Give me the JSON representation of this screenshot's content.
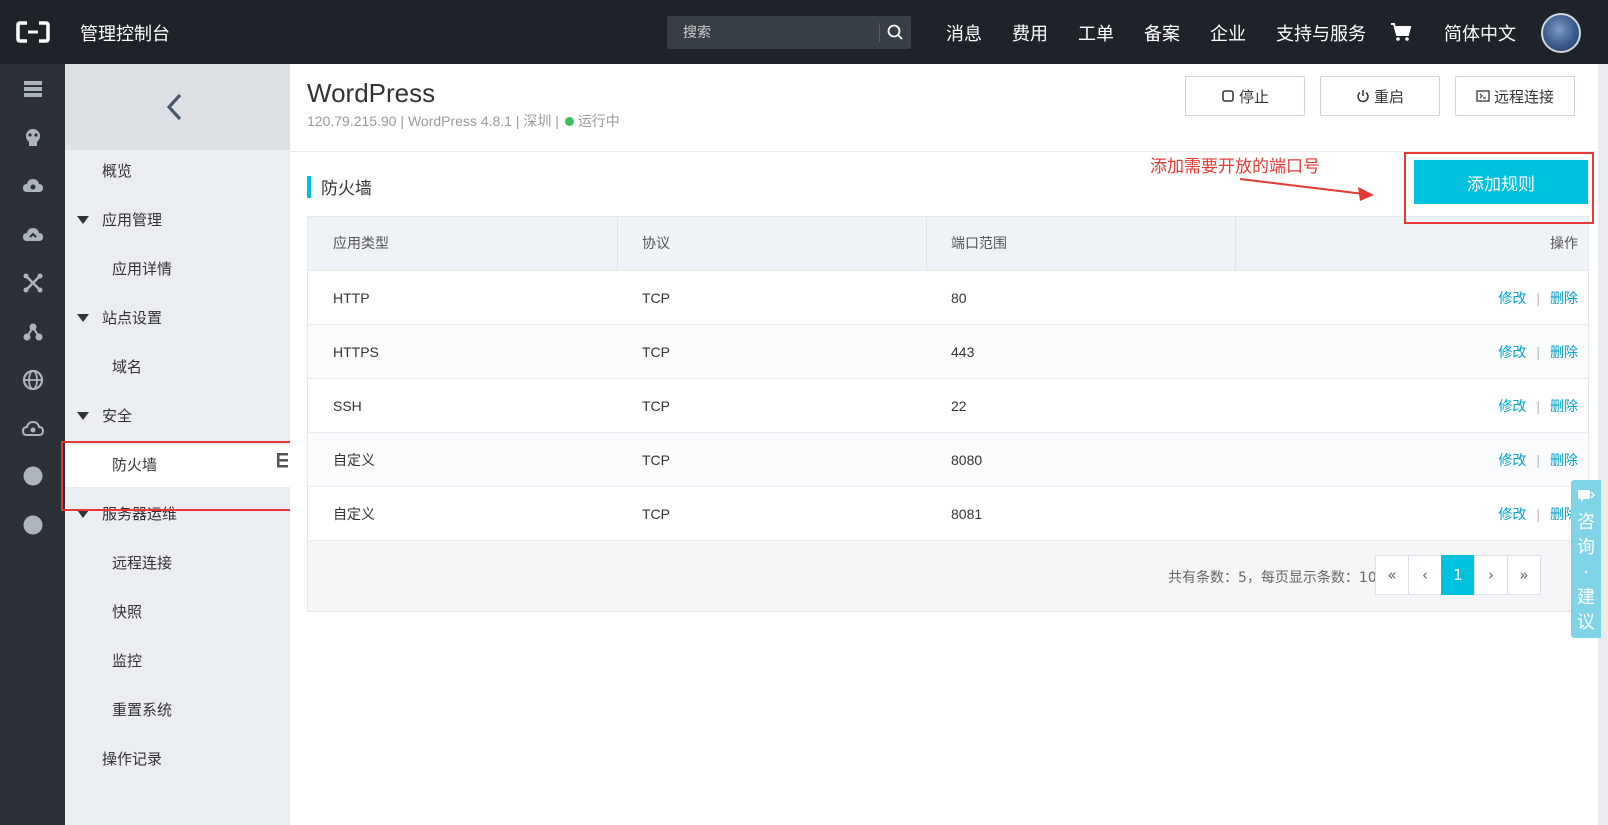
{
  "topbar": {
    "brand": "管理控制台",
    "search_placeholder": "搜索",
    "nav": [
      "消息",
      "费用",
      "工单",
      "备案",
      "企业",
      "支持与服务"
    ],
    "language": "简体中文"
  },
  "rail": {
    "icons": [
      "server-icon",
      "database-icon",
      "cloud-icon",
      "cloud-sync-icon",
      "network-icon",
      "cluster-icon",
      "globe-icon",
      "cloud-settings-icon",
      "circle-icon",
      "circle-icon"
    ]
  },
  "sidebar": {
    "items": [
      {
        "label": "概览",
        "type": "item"
      },
      {
        "label": "应用管理",
        "type": "group"
      },
      {
        "label": "应用详情",
        "type": "sub"
      },
      {
        "label": "站点设置",
        "type": "group"
      },
      {
        "label": "域名",
        "type": "sub"
      },
      {
        "label": "安全",
        "type": "group"
      },
      {
        "label": "防火墙",
        "type": "sub",
        "active": true
      },
      {
        "label": "服务器运维",
        "type": "group"
      },
      {
        "label": "远程连接",
        "type": "sub"
      },
      {
        "label": "快照",
        "type": "sub"
      },
      {
        "label": "监控",
        "type": "sub"
      },
      {
        "label": "重置系统",
        "type": "sub"
      },
      {
        "label": "操作记录",
        "type": "item"
      }
    ]
  },
  "header": {
    "title": "WordPress",
    "ip": "120.79.215.90",
    "version": "WordPress 4.8.1",
    "region": "深圳",
    "status": "运行中",
    "buttons": {
      "stop": "停止",
      "restart": "重启",
      "remote": "远程连接"
    }
  },
  "section": {
    "title": "防火墙",
    "add_button": "添加规则",
    "annotation": "添加需要开放的端口号"
  },
  "table": {
    "columns": [
      "应用类型",
      "协议",
      "端口范围",
      "操作"
    ],
    "rows": [
      {
        "app": "HTTP",
        "protocol": "TCP",
        "port": "80"
      },
      {
        "app": "HTTPS",
        "protocol": "TCP",
        "port": "443"
      },
      {
        "app": "SSH",
        "protocol": "TCP",
        "port": "22"
      },
      {
        "app": "自定义",
        "protocol": "TCP",
        "port": "8080"
      },
      {
        "app": "自定义",
        "protocol": "TCP",
        "port": "8081"
      }
    ],
    "edit_label": "修改",
    "delete_label": "删除",
    "summary": "共有条数：5，每页显示条数：10"
  },
  "pager": {
    "first": "«",
    "prev": "‹",
    "current": "1",
    "next": "›",
    "last": "»"
  },
  "consult": {
    "label": "咨询·建议"
  },
  "colors": {
    "accent": "#00c1de",
    "link": "#00a2ca",
    "annotation_red": "#e53935",
    "topbar": "#1e2329"
  }
}
